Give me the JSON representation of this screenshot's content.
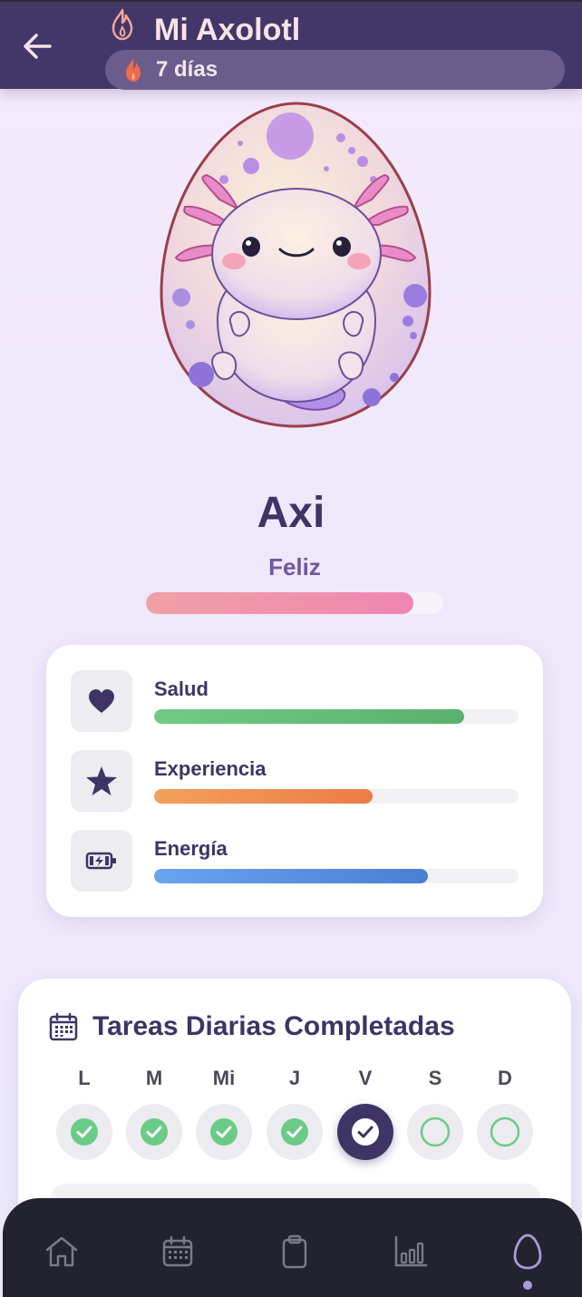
{
  "header": {
    "title": "Mi Axolotl",
    "streak": "7 días"
  },
  "pet": {
    "name": "Axi",
    "mood": "Feliz",
    "mood_level": 0.9
  },
  "stats": [
    {
      "label": "Salud",
      "icon": "heart-icon",
      "value": 0.85,
      "color": "#5fb574"
    },
    {
      "label": "Experiencia",
      "icon": "star-icon",
      "value": 0.6,
      "color": "#ef8a4e"
    },
    {
      "label": "Energía",
      "icon": "battery-charging-icon",
      "value": 0.75,
      "color": "#4f87d8"
    }
  ],
  "tasks": {
    "title": "Tareas Diarias Completadas",
    "days": [
      {
        "label": "L",
        "state": "done"
      },
      {
        "label": "M",
        "state": "done"
      },
      {
        "label": "Mi",
        "state": "done"
      },
      {
        "label": "J",
        "state": "done"
      },
      {
        "label": "V",
        "state": "today"
      },
      {
        "label": "S",
        "state": "pending"
      },
      {
        "label": "D",
        "state": "pending"
      }
    ]
  },
  "nav": {
    "items": [
      "home-icon",
      "calendar-icon",
      "clipboard-icon",
      "chart-icon",
      "egg-icon"
    ],
    "active": "egg-icon"
  },
  "colors": {
    "header_bg": "#433668",
    "accent": "#3e3466",
    "done_green": "#6acb87",
    "mood_gradient_start": "#f1a0a6",
    "mood_gradient_end": "#ef86b1"
  }
}
